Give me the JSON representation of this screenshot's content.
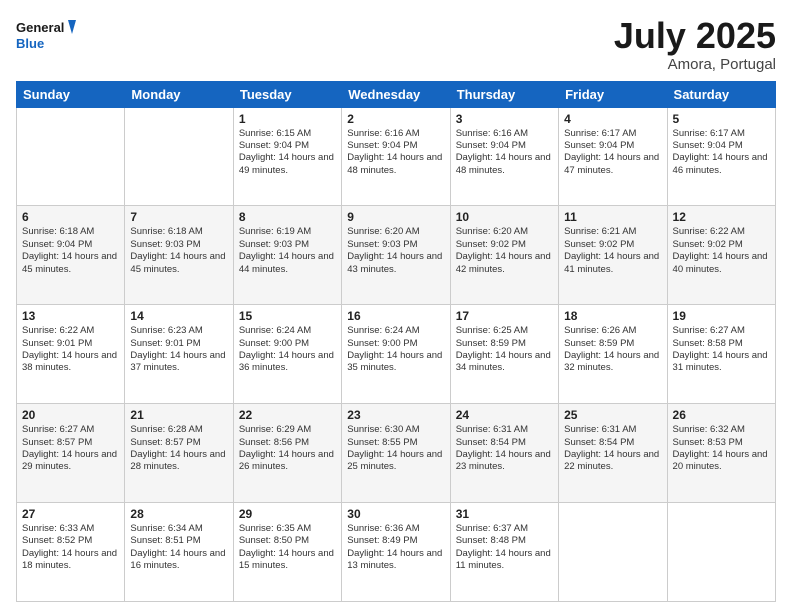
{
  "logo": {
    "line1": "General",
    "line2": "Blue"
  },
  "title": "July 2025",
  "subtitle": "Amora, Portugal",
  "days_of_week": [
    "Sunday",
    "Monday",
    "Tuesday",
    "Wednesday",
    "Thursday",
    "Friday",
    "Saturday"
  ],
  "weeks": [
    [
      {
        "day": "",
        "content": ""
      },
      {
        "day": "",
        "content": ""
      },
      {
        "day": "1",
        "content": "Sunrise: 6:15 AM\nSunset: 9:04 PM\nDaylight: 14 hours and 49 minutes."
      },
      {
        "day": "2",
        "content": "Sunrise: 6:16 AM\nSunset: 9:04 PM\nDaylight: 14 hours and 48 minutes."
      },
      {
        "day": "3",
        "content": "Sunrise: 6:16 AM\nSunset: 9:04 PM\nDaylight: 14 hours and 48 minutes."
      },
      {
        "day": "4",
        "content": "Sunrise: 6:17 AM\nSunset: 9:04 PM\nDaylight: 14 hours and 47 minutes."
      },
      {
        "day": "5",
        "content": "Sunrise: 6:17 AM\nSunset: 9:04 PM\nDaylight: 14 hours and 46 minutes."
      }
    ],
    [
      {
        "day": "6",
        "content": "Sunrise: 6:18 AM\nSunset: 9:04 PM\nDaylight: 14 hours and 45 minutes."
      },
      {
        "day": "7",
        "content": "Sunrise: 6:18 AM\nSunset: 9:03 PM\nDaylight: 14 hours and 45 minutes."
      },
      {
        "day": "8",
        "content": "Sunrise: 6:19 AM\nSunset: 9:03 PM\nDaylight: 14 hours and 44 minutes."
      },
      {
        "day": "9",
        "content": "Sunrise: 6:20 AM\nSunset: 9:03 PM\nDaylight: 14 hours and 43 minutes."
      },
      {
        "day": "10",
        "content": "Sunrise: 6:20 AM\nSunset: 9:02 PM\nDaylight: 14 hours and 42 minutes."
      },
      {
        "day": "11",
        "content": "Sunrise: 6:21 AM\nSunset: 9:02 PM\nDaylight: 14 hours and 41 minutes."
      },
      {
        "day": "12",
        "content": "Sunrise: 6:22 AM\nSunset: 9:02 PM\nDaylight: 14 hours and 40 minutes."
      }
    ],
    [
      {
        "day": "13",
        "content": "Sunrise: 6:22 AM\nSunset: 9:01 PM\nDaylight: 14 hours and 38 minutes."
      },
      {
        "day": "14",
        "content": "Sunrise: 6:23 AM\nSunset: 9:01 PM\nDaylight: 14 hours and 37 minutes."
      },
      {
        "day": "15",
        "content": "Sunrise: 6:24 AM\nSunset: 9:00 PM\nDaylight: 14 hours and 36 minutes."
      },
      {
        "day": "16",
        "content": "Sunrise: 6:24 AM\nSunset: 9:00 PM\nDaylight: 14 hours and 35 minutes."
      },
      {
        "day": "17",
        "content": "Sunrise: 6:25 AM\nSunset: 8:59 PM\nDaylight: 14 hours and 34 minutes."
      },
      {
        "day": "18",
        "content": "Sunrise: 6:26 AM\nSunset: 8:59 PM\nDaylight: 14 hours and 32 minutes."
      },
      {
        "day": "19",
        "content": "Sunrise: 6:27 AM\nSunset: 8:58 PM\nDaylight: 14 hours and 31 minutes."
      }
    ],
    [
      {
        "day": "20",
        "content": "Sunrise: 6:27 AM\nSunset: 8:57 PM\nDaylight: 14 hours and 29 minutes."
      },
      {
        "day": "21",
        "content": "Sunrise: 6:28 AM\nSunset: 8:57 PM\nDaylight: 14 hours and 28 minutes."
      },
      {
        "day": "22",
        "content": "Sunrise: 6:29 AM\nSunset: 8:56 PM\nDaylight: 14 hours and 26 minutes."
      },
      {
        "day": "23",
        "content": "Sunrise: 6:30 AM\nSunset: 8:55 PM\nDaylight: 14 hours and 25 minutes."
      },
      {
        "day": "24",
        "content": "Sunrise: 6:31 AM\nSunset: 8:54 PM\nDaylight: 14 hours and 23 minutes."
      },
      {
        "day": "25",
        "content": "Sunrise: 6:31 AM\nSunset: 8:54 PM\nDaylight: 14 hours and 22 minutes."
      },
      {
        "day": "26",
        "content": "Sunrise: 6:32 AM\nSunset: 8:53 PM\nDaylight: 14 hours and 20 minutes."
      }
    ],
    [
      {
        "day": "27",
        "content": "Sunrise: 6:33 AM\nSunset: 8:52 PM\nDaylight: 14 hours and 18 minutes."
      },
      {
        "day": "28",
        "content": "Sunrise: 6:34 AM\nSunset: 8:51 PM\nDaylight: 14 hours and 16 minutes."
      },
      {
        "day": "29",
        "content": "Sunrise: 6:35 AM\nSunset: 8:50 PM\nDaylight: 14 hours and 15 minutes."
      },
      {
        "day": "30",
        "content": "Sunrise: 6:36 AM\nSunset: 8:49 PM\nDaylight: 14 hours and 13 minutes."
      },
      {
        "day": "31",
        "content": "Sunrise: 6:37 AM\nSunset: 8:48 PM\nDaylight: 14 hours and 11 minutes."
      },
      {
        "day": "",
        "content": ""
      },
      {
        "day": "",
        "content": ""
      }
    ]
  ]
}
